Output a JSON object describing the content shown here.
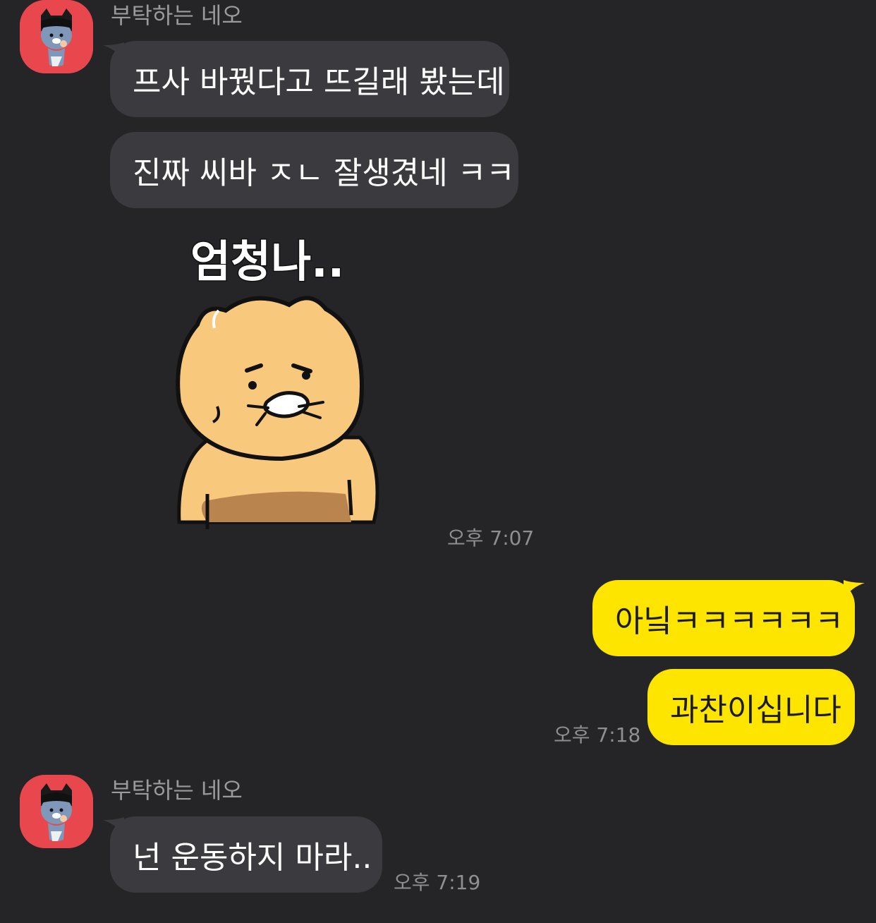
{
  "theme": {
    "background": "#252527",
    "incoming_bubble": "#3b3b3f",
    "outgoing_bubble": "#fee500",
    "avatar_bg": "#e8474d"
  },
  "group1": {
    "sender": "부탁하는 네오",
    "messages": [
      "프사 바꿨다고 뜨길래 봤는데",
      "진짜 씨바 ㅈㄴ 잘생겼네 ㅋㅋ"
    ],
    "sticker": {
      "text": "엄청나..",
      "icon": "sticker-bear-icon"
    },
    "time": "오후 7:07"
  },
  "group2": {
    "messages": [
      "아닠ㅋㅋㅋㅋㅋㅋ",
      "과찬이십니다"
    ],
    "time": "오후 7:18"
  },
  "group3": {
    "sender": "부탁하는 네오",
    "messages": [
      "넌 운동하지 마라.."
    ],
    "time": "오후 7:19"
  }
}
